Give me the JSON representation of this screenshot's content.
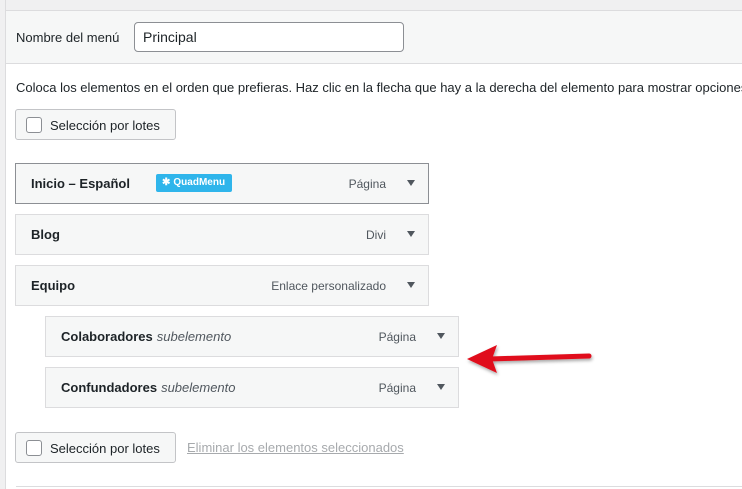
{
  "menu_name": {
    "label": "Nombre del menú",
    "value": "Principal"
  },
  "instructions": "Coloca los elementos en el orden que prefieras. Haz clic en la flecha que hay a la derecha del elemento para mostrar opciones de configuración adicionales.",
  "bulk_select": {
    "label": "Selección por lotes"
  },
  "items": [
    {
      "title": "Inicio – Español",
      "type": "Página",
      "badge": "QuadMenu"
    },
    {
      "title": "Blog",
      "type": "Divi"
    },
    {
      "title": "Equipo",
      "type": "Enlace personalizado"
    },
    {
      "title": "Colaboradores",
      "sub": "subelemento",
      "type": "Página"
    },
    {
      "title": "Confundadores",
      "sub": "subelemento",
      "type": "Página"
    }
  ],
  "delete_selected": "Eliminar los elementos seleccionados",
  "annotation": {
    "arrow_color": "#e0111b"
  },
  "colors": {
    "badge": "#2fb5eb",
    "link_disabled": "#a7aaad"
  }
}
